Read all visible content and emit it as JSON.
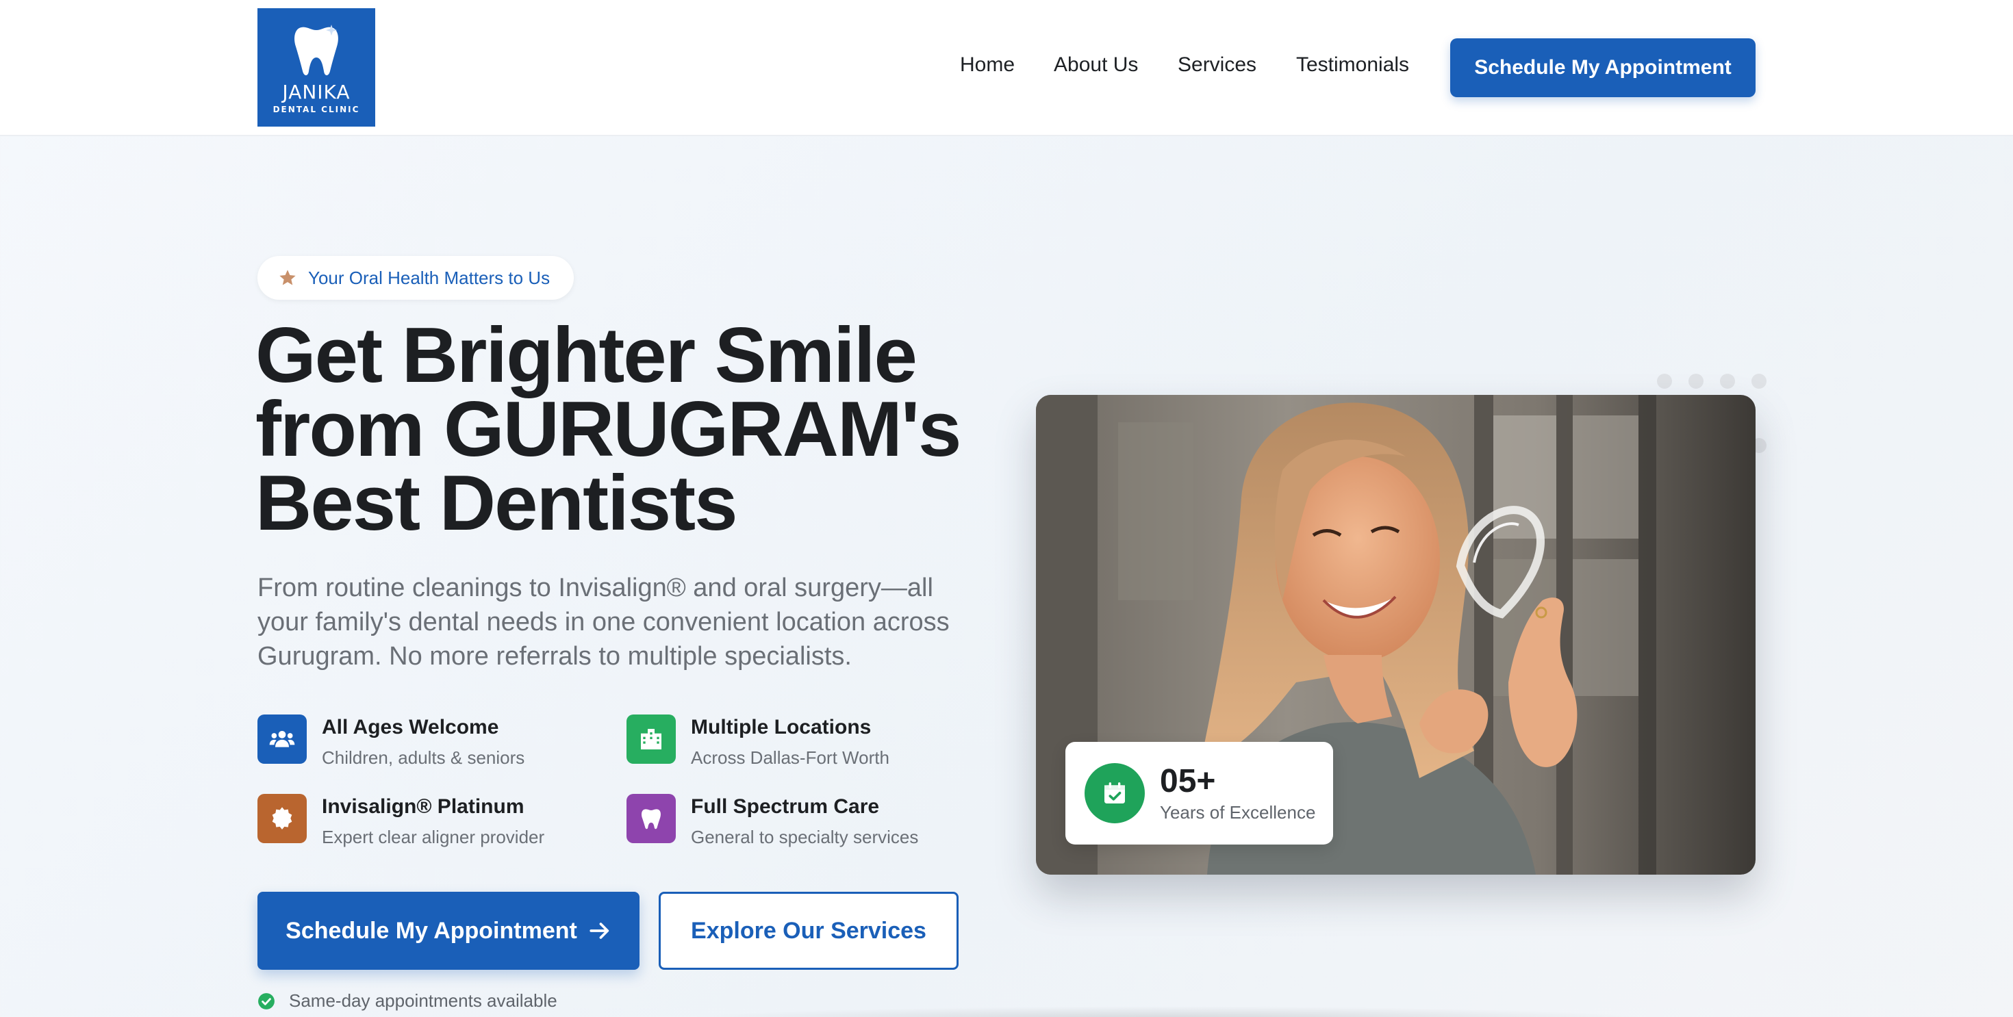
{
  "brand": {
    "name": "JANIKA",
    "tagline": "DENTAL CLINIC",
    "color": "#1a5fb8"
  },
  "nav": {
    "items": [
      {
        "label": "Home"
      },
      {
        "label": "About Us"
      },
      {
        "label": "Services"
      },
      {
        "label": "Testimonials"
      }
    ],
    "cta_label": "Schedule My Appointment"
  },
  "hero": {
    "badge": {
      "icon": "star-icon",
      "text": "Your Oral Health Matters to Us"
    },
    "title_lines": [
      "Get Brighter Smile",
      "from GURUGRAM's",
      "Best Dentists"
    ],
    "description": "From routine cleanings to Invisalign® and oral surgery—all your family's dental needs in one convenient location across Gurugram. No more referrals to multiple specialists.",
    "features": [
      {
        "title": "All Ages Welcome",
        "subtitle": "Children, adults & seniors",
        "icon": "users-icon",
        "color": "#1a5fb8"
      },
      {
        "title": "Multiple Locations",
        "subtitle": "Across Dallas-Fort Worth",
        "icon": "building-icon",
        "color": "#27ae60"
      },
      {
        "title": "Invisalign® Platinum",
        "subtitle": "Expert clear aligner provider",
        "icon": "award-icon",
        "color": "#b9652f"
      },
      {
        "title": "Full Spectrum Care",
        "subtitle": "General to specialty services",
        "icon": "tooth-icon",
        "color": "#8e44ad"
      }
    ],
    "primary_button": "Schedule My Appointment",
    "secondary_button": "Explore Our Services",
    "note": {
      "icon": "check-circle-icon",
      "text": "Same-day appointments available",
      "color": "#27ae60"
    }
  },
  "stat_card": {
    "value": "05+",
    "label": "Years of Excellence",
    "icon": "calendar-check-icon",
    "color": "#1fa35a"
  }
}
